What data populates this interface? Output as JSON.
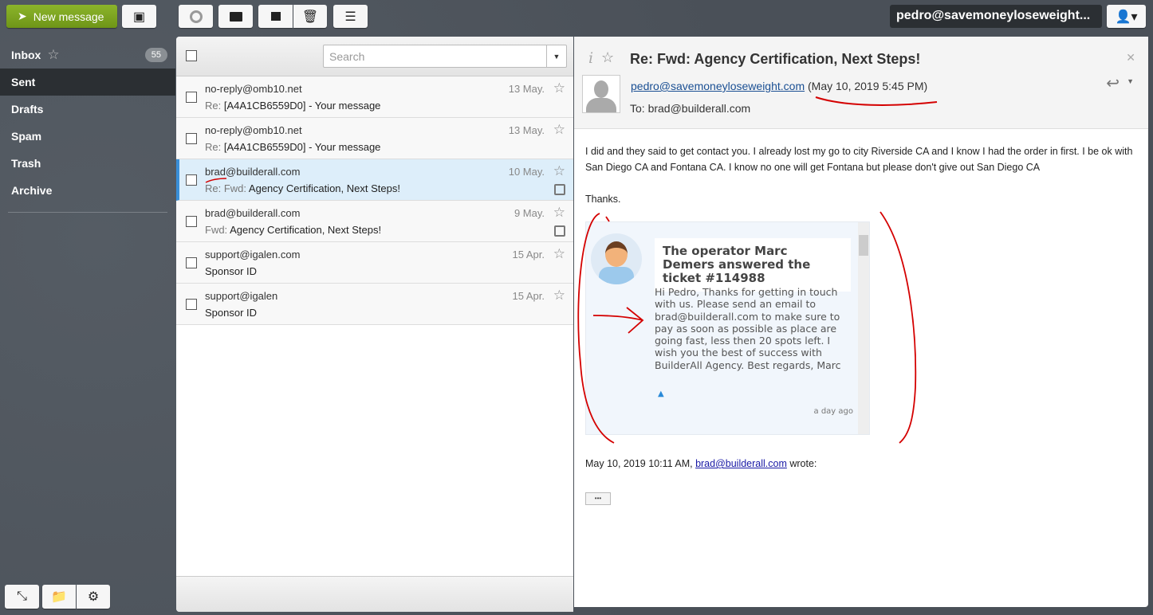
{
  "toolbar": {
    "new_message": "New message",
    "user": "pedro@savemoneyloseweight..."
  },
  "folders": [
    {
      "label": "Inbox",
      "unread": "55"
    },
    {
      "label": "Sent"
    },
    {
      "label": "Drafts"
    },
    {
      "label": "Spam"
    },
    {
      "label": "Trash"
    },
    {
      "label": "Archive"
    }
  ],
  "list": {
    "search_placeholder": "Search",
    "messages": [
      {
        "from": "no-reply@omb10.net",
        "prefix": "Re: ",
        "subject": "[A4A1CB6559D0] - Your message",
        "date": "13 May.",
        "attachment": false
      },
      {
        "from": "no-reply@omb10.net",
        "prefix": "Re: ",
        "subject": "[A4A1CB6559D0] - Your message",
        "date": "13 May.",
        "attachment": false
      },
      {
        "from": "brad@builderall.com",
        "prefix": "Re: Fwd: ",
        "subject": "Agency Certification, Next Steps!",
        "date": "10 May.",
        "attachment": true,
        "selected": true
      },
      {
        "from": "brad@builderall.com",
        "prefix": "Fwd: ",
        "subject": "Agency Certification, Next Steps!",
        "date": "9 May.",
        "attachment": true
      },
      {
        "from": "support@igalen.com",
        "prefix": "",
        "subject": "Sponsor ID",
        "date": "15 Apr.",
        "attachment": false
      },
      {
        "from": "support@igalen",
        "prefix": "",
        "subject": "Sponsor ID",
        "date": "15 Apr.",
        "attachment": false
      }
    ]
  },
  "message": {
    "subject": "Re: Fwd: Agency Certification, Next Steps!",
    "from": "pedro@savemoneyloseweight.com",
    "date": "(May 10, 2019 5:45 PM)",
    "to": "To: brad@builderall.com",
    "body": "I did and they said to get contact you. I already lost my go to city Riverside CA and I know I had the order in first. I be ok with San Diego CA and Fontana CA. I know no one will get Fontana but please don't give out San Diego CA",
    "thanks": "Thanks.",
    "quote_title": "The operator Marc Demers answered the ticket #114988",
    "quote_text": "Hi Pedro, Thanks for getting in touch with us. Please send an email to brad@builderall.com to make sure to pay as soon as possible as place are going fast, less then 20 spots left. I wish you the best of success with BuilderAll Agency. Best regards, Marc",
    "quote_time": "a day ago",
    "wrote_prefix": "May 10, 2019 10:11 AM, ",
    "wrote_link": "brad@builderall.com",
    "wrote_suffix": " wrote:",
    "more": "•••"
  },
  "colors": {
    "accent": "#7ba022",
    "selected": "#ddeefa",
    "annotation": "#d40000"
  }
}
